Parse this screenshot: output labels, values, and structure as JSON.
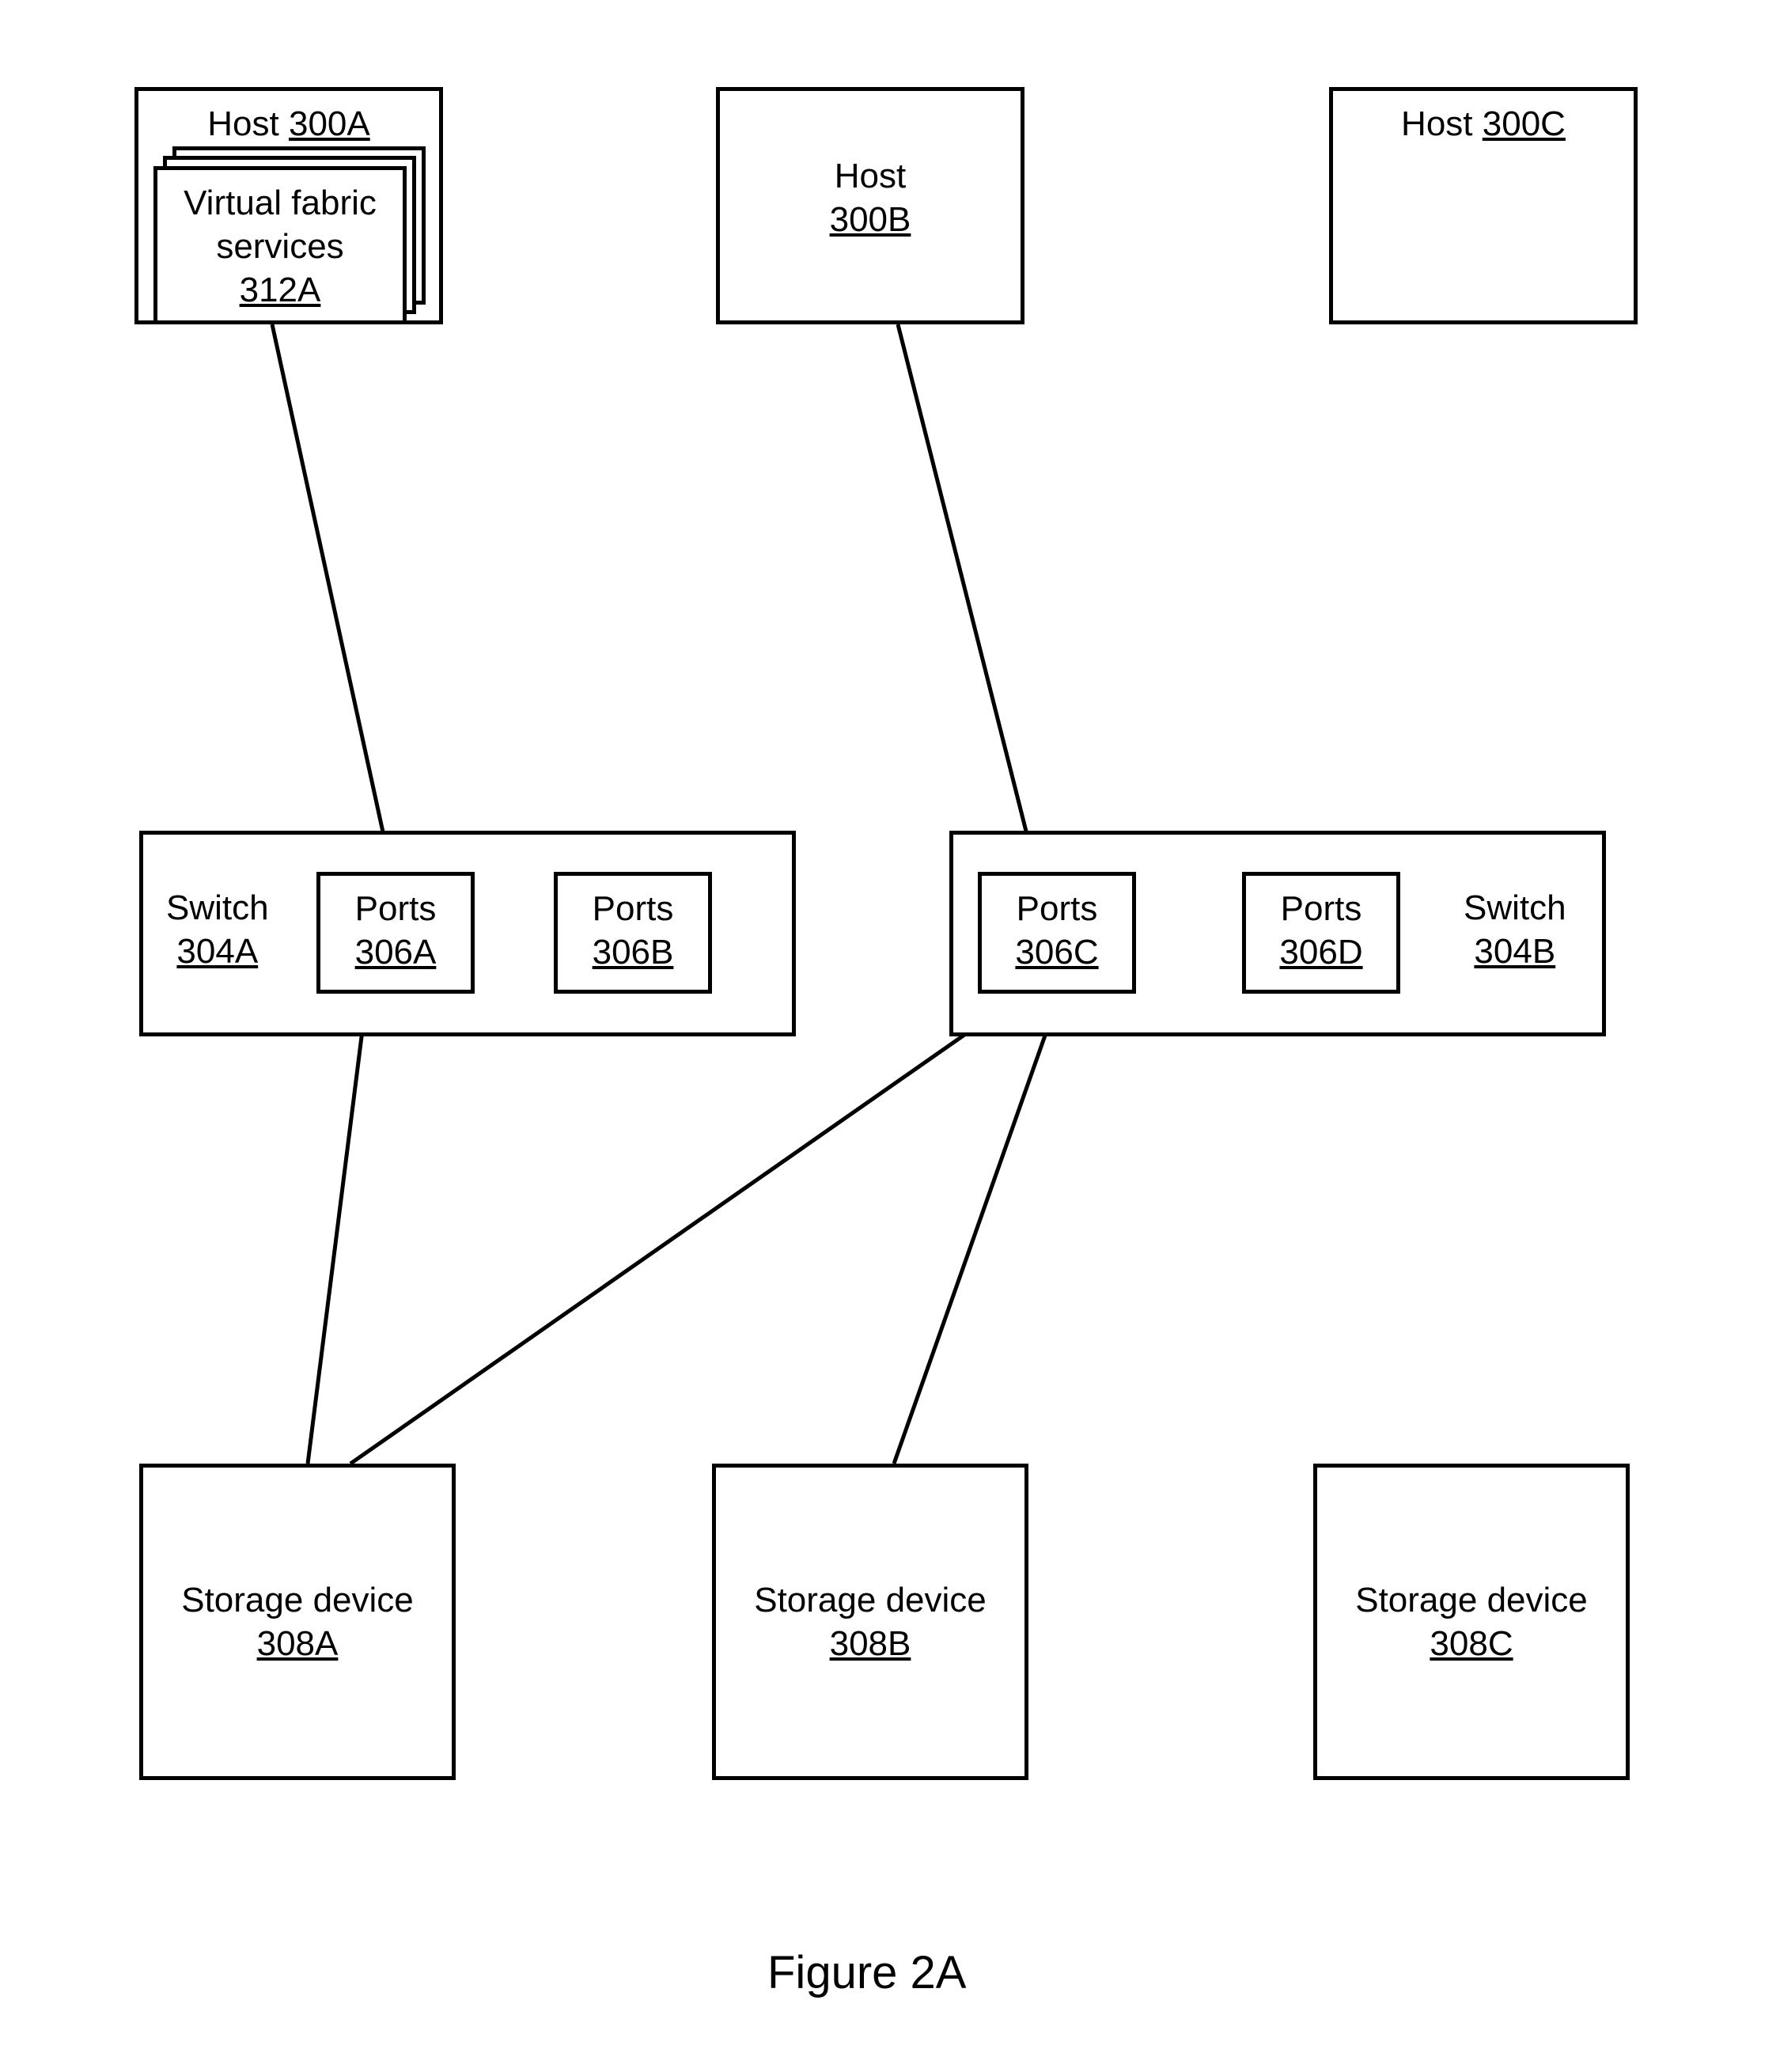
{
  "figure_caption": "Figure 2A",
  "hostA": {
    "title_prefix": "Host ",
    "ref": "300A"
  },
  "hostB": {
    "title": "Host",
    "ref": "300B"
  },
  "hostC": {
    "title_prefix": "Host ",
    "ref": "300C"
  },
  "vfs": {
    "title": "Virtual fabric",
    "title2": "services",
    "ref": "312A"
  },
  "switchA": {
    "title": "Switch",
    "ref": "304A"
  },
  "switchB": {
    "title": "Switch",
    "ref": "304B"
  },
  "portsA": {
    "title": "Ports",
    "ref": "306A"
  },
  "portsB": {
    "title": "Ports",
    "ref": "306B"
  },
  "portsC": {
    "title": "Ports",
    "ref": "306C"
  },
  "portsD": {
    "title": "Ports",
    "ref": "306D"
  },
  "storageA": {
    "title": "Storage device",
    "ref": "308A"
  },
  "storageB": {
    "title": "Storage device",
    "ref": "308B"
  },
  "storageC": {
    "title": "Storage device",
    "ref": "308C"
  }
}
